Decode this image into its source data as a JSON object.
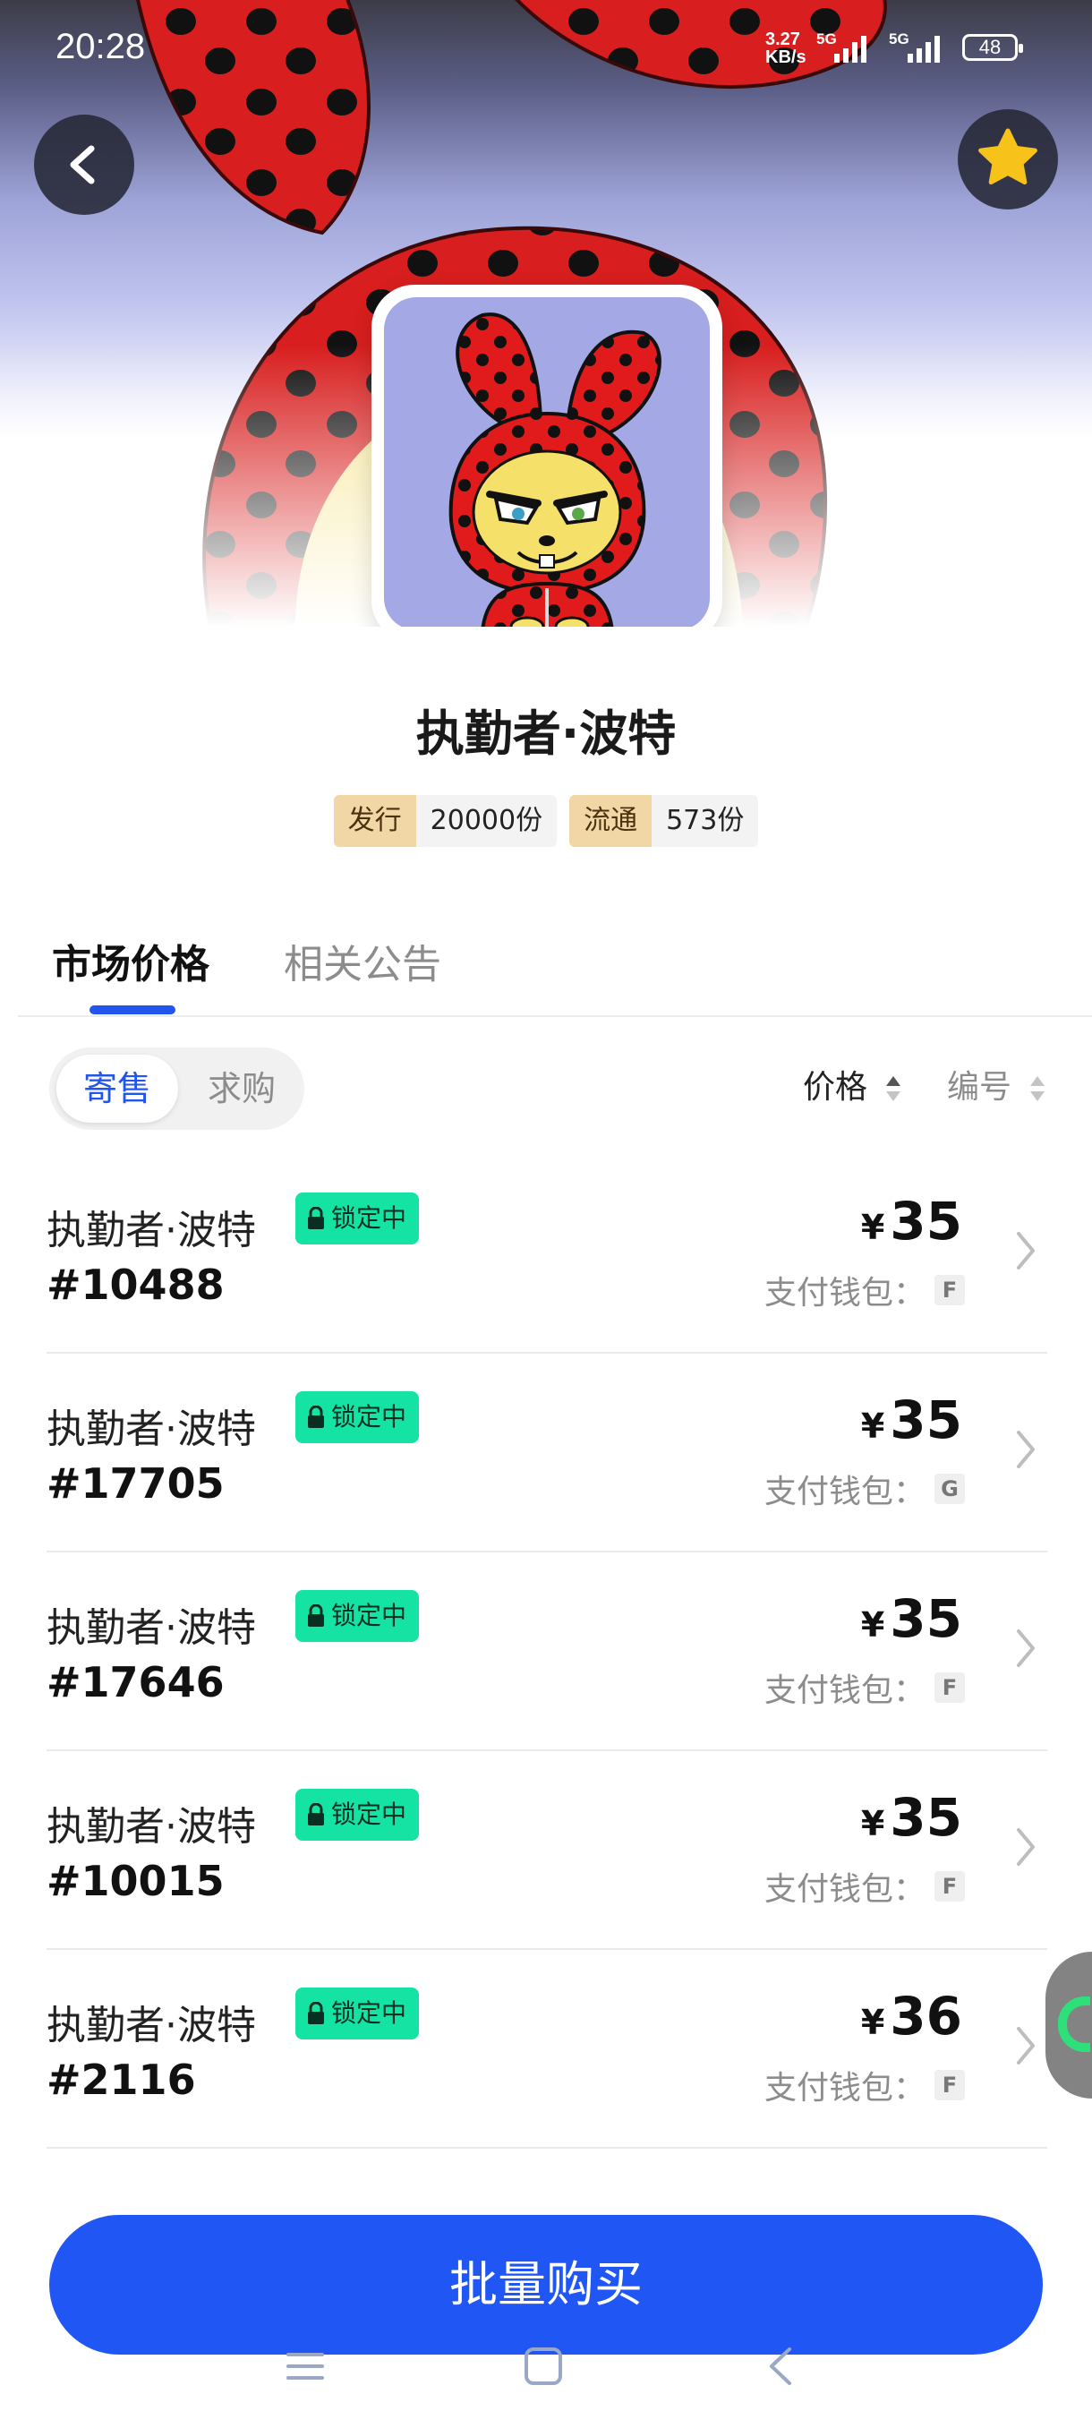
{
  "status_bar": {
    "time": "20:28",
    "net_speed_value": "3.27",
    "net_speed_unit": "KB/s",
    "signal1": "5G",
    "signal2": "5G",
    "battery": "48"
  },
  "header": {
    "back_icon": "chevron-left-icon",
    "favorite_icon": "star-icon",
    "favorite_color": "#f7c21a"
  },
  "product": {
    "title": "执勤者·波特",
    "stats": [
      {
        "label": "发行",
        "value": "20000份"
      },
      {
        "label": "流通",
        "value": "573份"
      }
    ]
  },
  "tabs": [
    {
      "label": "市场价格",
      "active": true
    },
    {
      "label": "相关公告",
      "active": false
    }
  ],
  "filter": {
    "segments": [
      {
        "label": "寄售",
        "active": true
      },
      {
        "label": "求购",
        "active": false
      }
    ],
    "sort": [
      {
        "label": "价格"
      },
      {
        "label": "编号"
      }
    ]
  },
  "listings": [
    {
      "name": "执勤者·波特",
      "badge": "锁定中",
      "number": "#10488",
      "currency": "¥",
      "price": "35",
      "wallet_label": "支付钱包：",
      "wallet_code": "F"
    },
    {
      "name": "执勤者·波特",
      "badge": "锁定中",
      "number": "#17705",
      "currency": "¥",
      "price": "35",
      "wallet_label": "支付钱包：",
      "wallet_code": "G"
    },
    {
      "name": "执勤者·波特",
      "badge": "锁定中",
      "number": "#17646",
      "currency": "¥",
      "price": "35",
      "wallet_label": "支付钱包：",
      "wallet_code": "F"
    },
    {
      "name": "执勤者·波特",
      "badge": "锁定中",
      "number": "#10015",
      "currency": "¥",
      "price": "35",
      "wallet_label": "支付钱包：",
      "wallet_code": "F"
    },
    {
      "name": "执勤者·波特",
      "badge": "锁定中",
      "number": "#2116",
      "currency": "¥",
      "price": "36",
      "wallet_label": "支付钱包：",
      "wallet_code": "F"
    }
  ],
  "colors": {
    "accent": "#1f56f4",
    "lock_badge": "#15e3a4",
    "stat_label_bg": "#f2d7a6"
  },
  "bottom": {
    "buy_label": "批量购买"
  }
}
